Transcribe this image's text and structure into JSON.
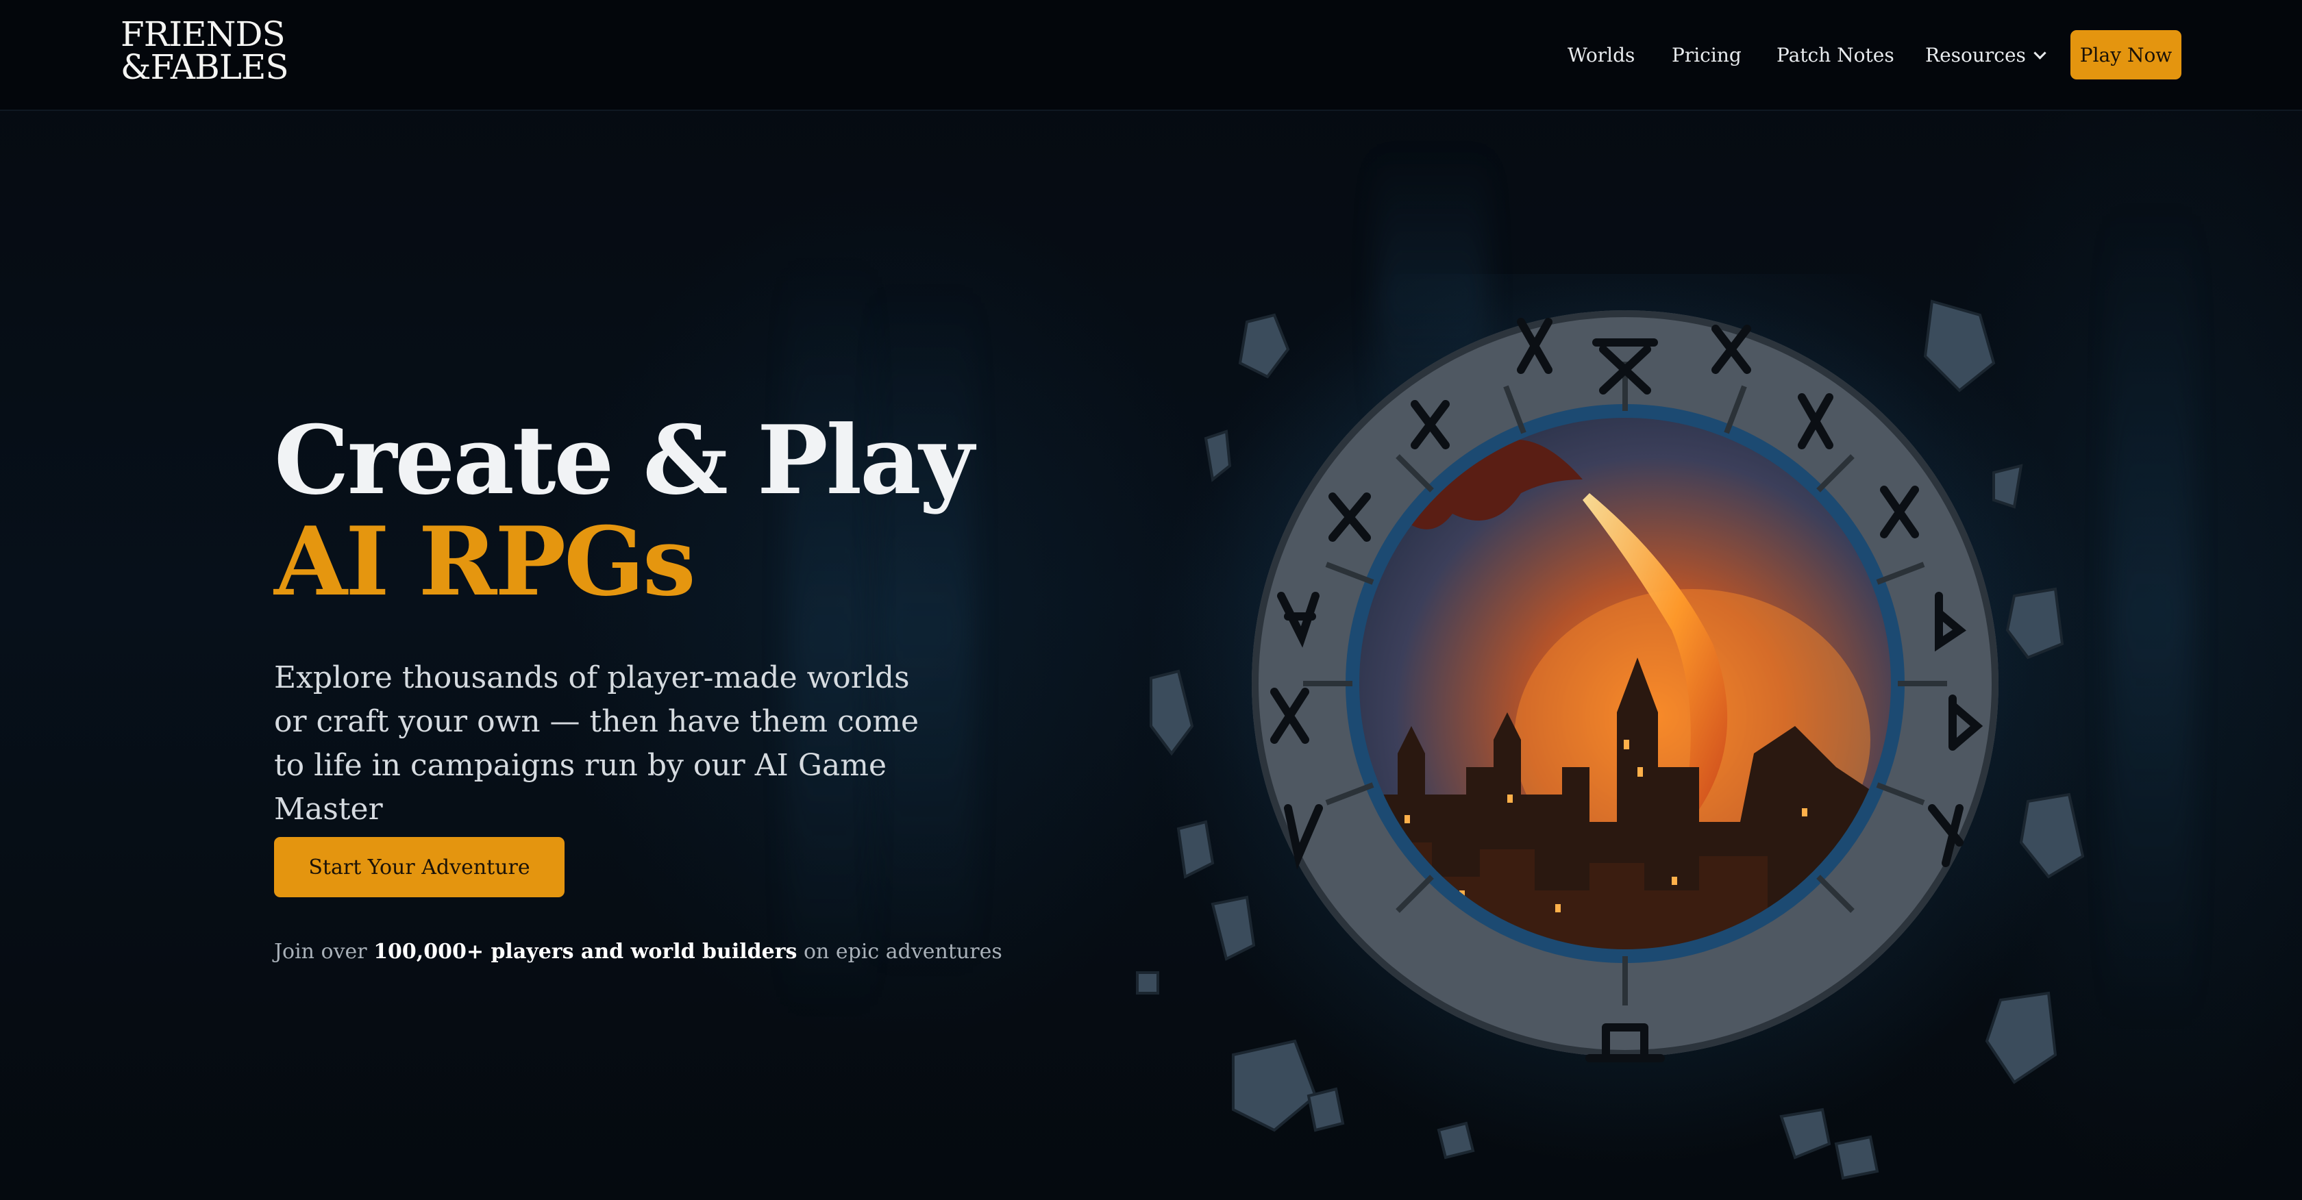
{
  "brand": {
    "logo_line1": "FRIENDS",
    "logo_line2": "&FABLES"
  },
  "nav": {
    "items": [
      {
        "label": "Worlds"
      },
      {
        "label": "Pricing"
      },
      {
        "label": "Patch Notes"
      },
      {
        "label": "Resources"
      }
    ],
    "play_now": "Play Now"
  },
  "hero": {
    "headline_line1": "Create & Play",
    "headline_line2": "AI RPGs",
    "subtext": "Explore thousands of player-made worlds or craft your own — then have them come to life in campaigns run by our AI Game Master",
    "cta": "Start Your Adventure",
    "social_prefix": "Join over ",
    "social_bold": "100,000+ players and world builders",
    "social_suffix": " on epic adventures"
  },
  "art": {
    "icon": "rune-portal-dragon-illustration"
  },
  "colors": {
    "accent": "#e5960f",
    "background": "#04070c",
    "text": "#eef1f4"
  }
}
